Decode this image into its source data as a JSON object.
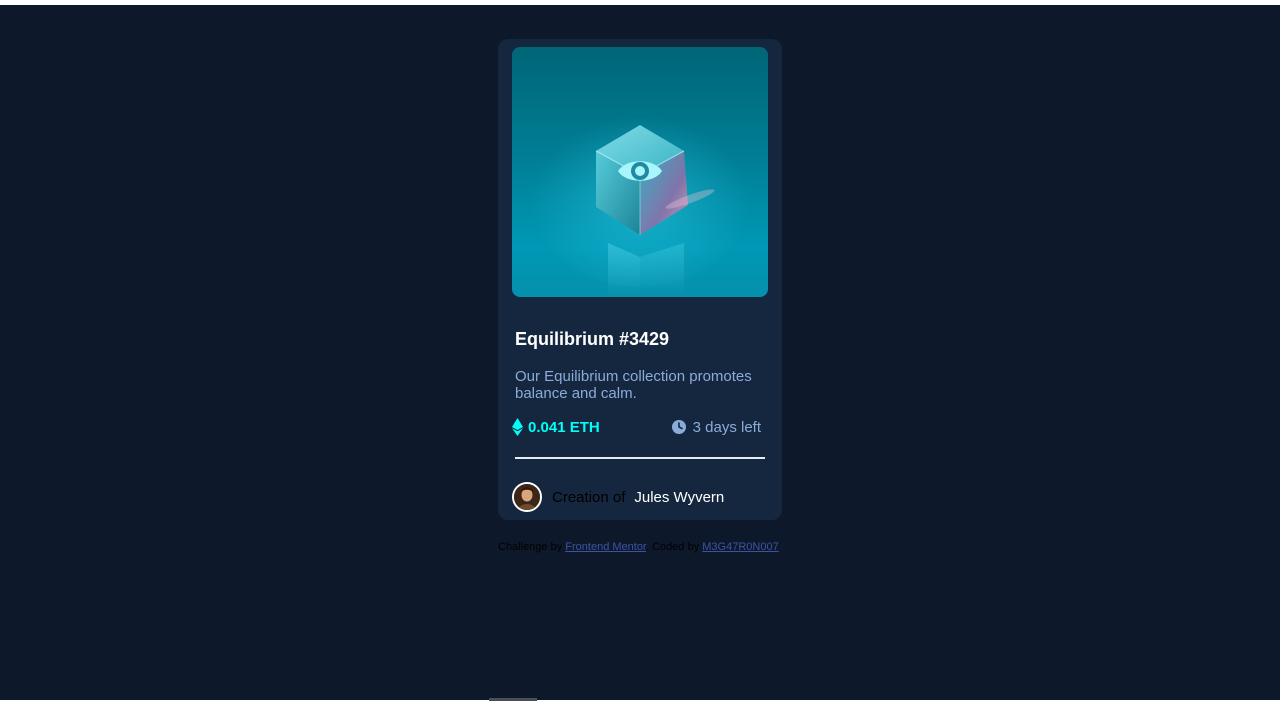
{
  "card": {
    "title": "Equilibrium #3429",
    "description": "Our Equilibrium collection promotes balance and calm.",
    "price": "0.041 ETH",
    "time_left": "3 days left",
    "creation_prefix": "Creation of",
    "creator_name": "Jules Wyvern"
  },
  "attribution": {
    "challenge_prefix": "Challenge by",
    "challenge_link": "Frontend Mentor",
    "coded_prefix": ". Coded by",
    "coder_link": "M3G47R0N007"
  },
  "icons": {
    "hero_overlay": "eye-icon",
    "price": "ethereum-icon",
    "time": "clock-icon"
  },
  "colors": {
    "page_bg": "#0d192b",
    "card_bg": "#15263f",
    "accent_cyan": "#00fff8",
    "soft_blue": "#8bacd9",
    "link": "#3e52a3"
  }
}
